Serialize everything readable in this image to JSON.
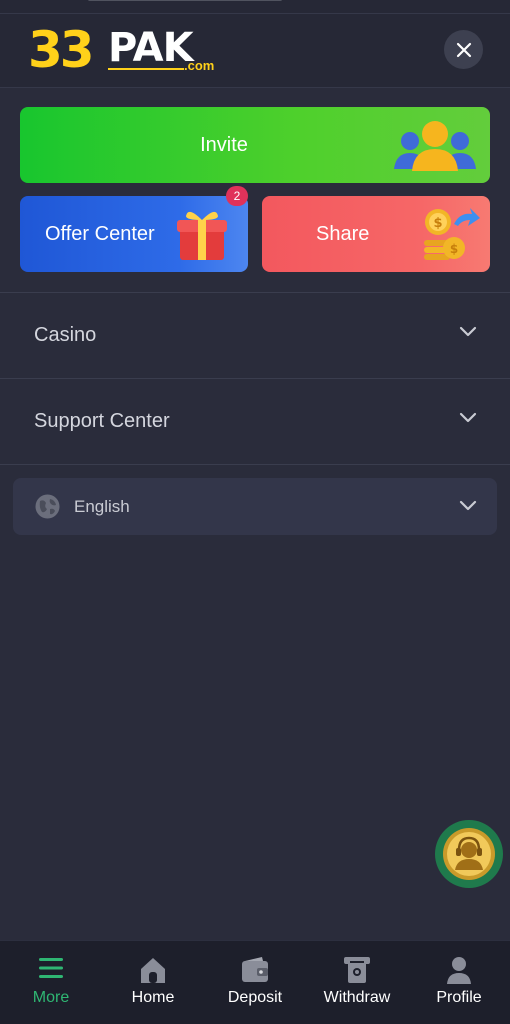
{
  "header": {
    "logo_number": "33",
    "logo_word": "PAK",
    "logo_suffix": ".com",
    "close_icon": "close-icon"
  },
  "promo": {
    "invite_label": "Invite",
    "offer_center_label": "Offer Center",
    "offer_center_badge": "2",
    "share_label": "Share"
  },
  "menu": {
    "items": [
      {
        "label": "Casino",
        "icon": "chevron-down-icon"
      },
      {
        "label": "Support Center",
        "icon": "chevron-down-icon"
      }
    ],
    "language": {
      "label": "English",
      "icon": "globe-icon"
    }
  },
  "tabbar": {
    "items": [
      {
        "label": "More",
        "icon": "menu-icon",
        "active": true
      },
      {
        "label": "Home",
        "icon": "home-icon",
        "active": false
      },
      {
        "label": "Deposit",
        "icon": "wallet-icon",
        "active": false
      },
      {
        "label": "Withdraw",
        "icon": "withdraw-icon",
        "active": false
      },
      {
        "label": "Profile",
        "icon": "user-icon",
        "active": false
      }
    ]
  },
  "colors": {
    "background": "#2a2c3b",
    "accent_green": "#2fb673",
    "logo_yellow": "#ffd11a",
    "invite_green": "#18c62e",
    "offer_blue": "#2e6be8",
    "share_red": "#f3585e",
    "badge_red": "#e0325a"
  }
}
